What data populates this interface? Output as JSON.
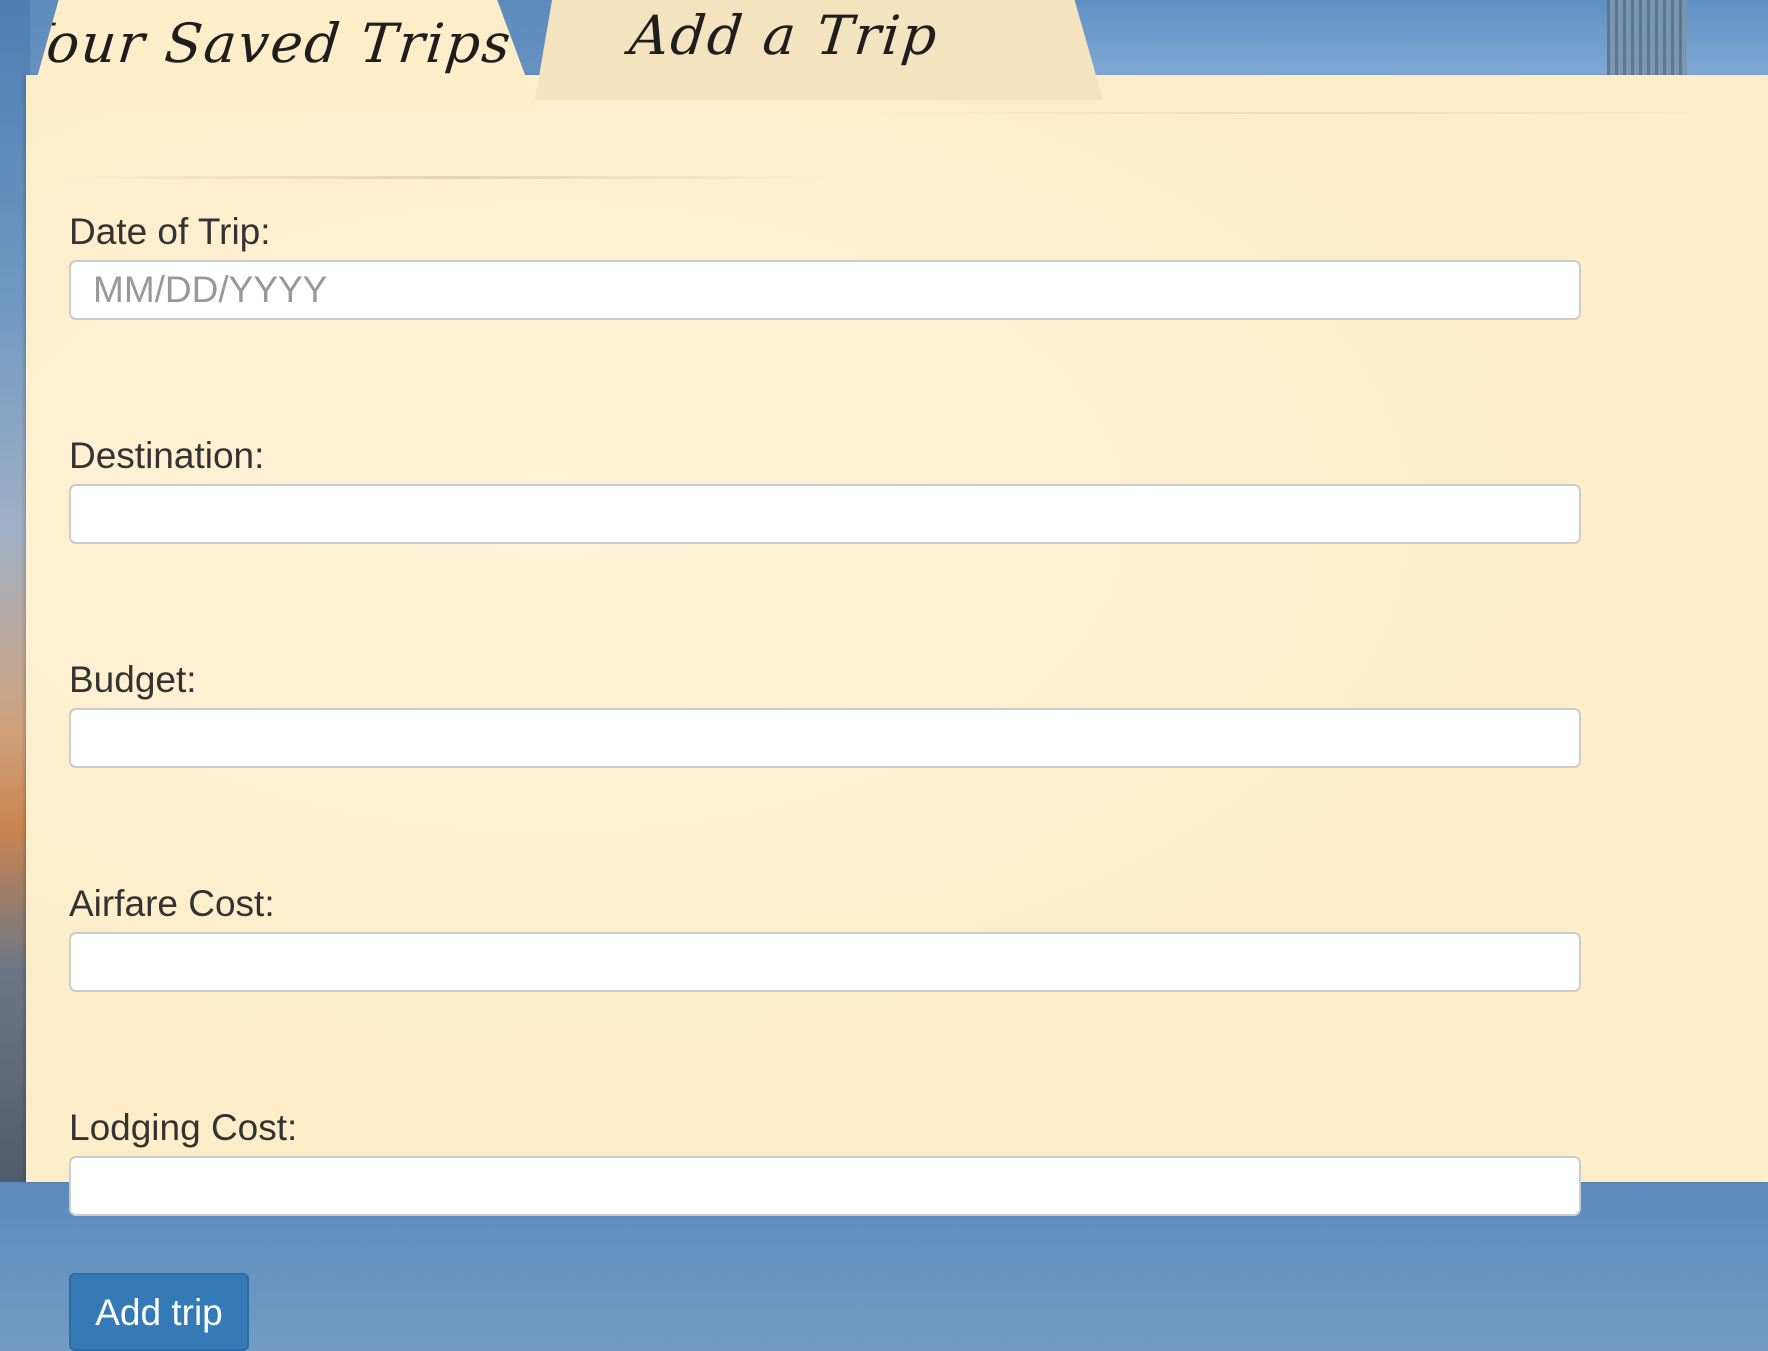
{
  "tabs": {
    "saved_trips": "Your Saved Trips",
    "add_trip": "Add a Trip"
  },
  "form": {
    "fields": [
      {
        "label": "Date of Trip:",
        "placeholder": "MM/DD/YYYY",
        "value": ""
      },
      {
        "label": "Destination:",
        "placeholder": "",
        "value": ""
      },
      {
        "label": "Budget:",
        "placeholder": "",
        "value": ""
      },
      {
        "label": "Airfare Cost:",
        "placeholder": "",
        "value": ""
      },
      {
        "label": "Lodging Cost:",
        "placeholder": "",
        "value": ""
      }
    ],
    "submit_label": "Add trip"
  },
  "colors": {
    "folder": "#fdedc9",
    "button": "#337ab7",
    "label_text": "#333333",
    "placeholder_text": "#999999"
  }
}
